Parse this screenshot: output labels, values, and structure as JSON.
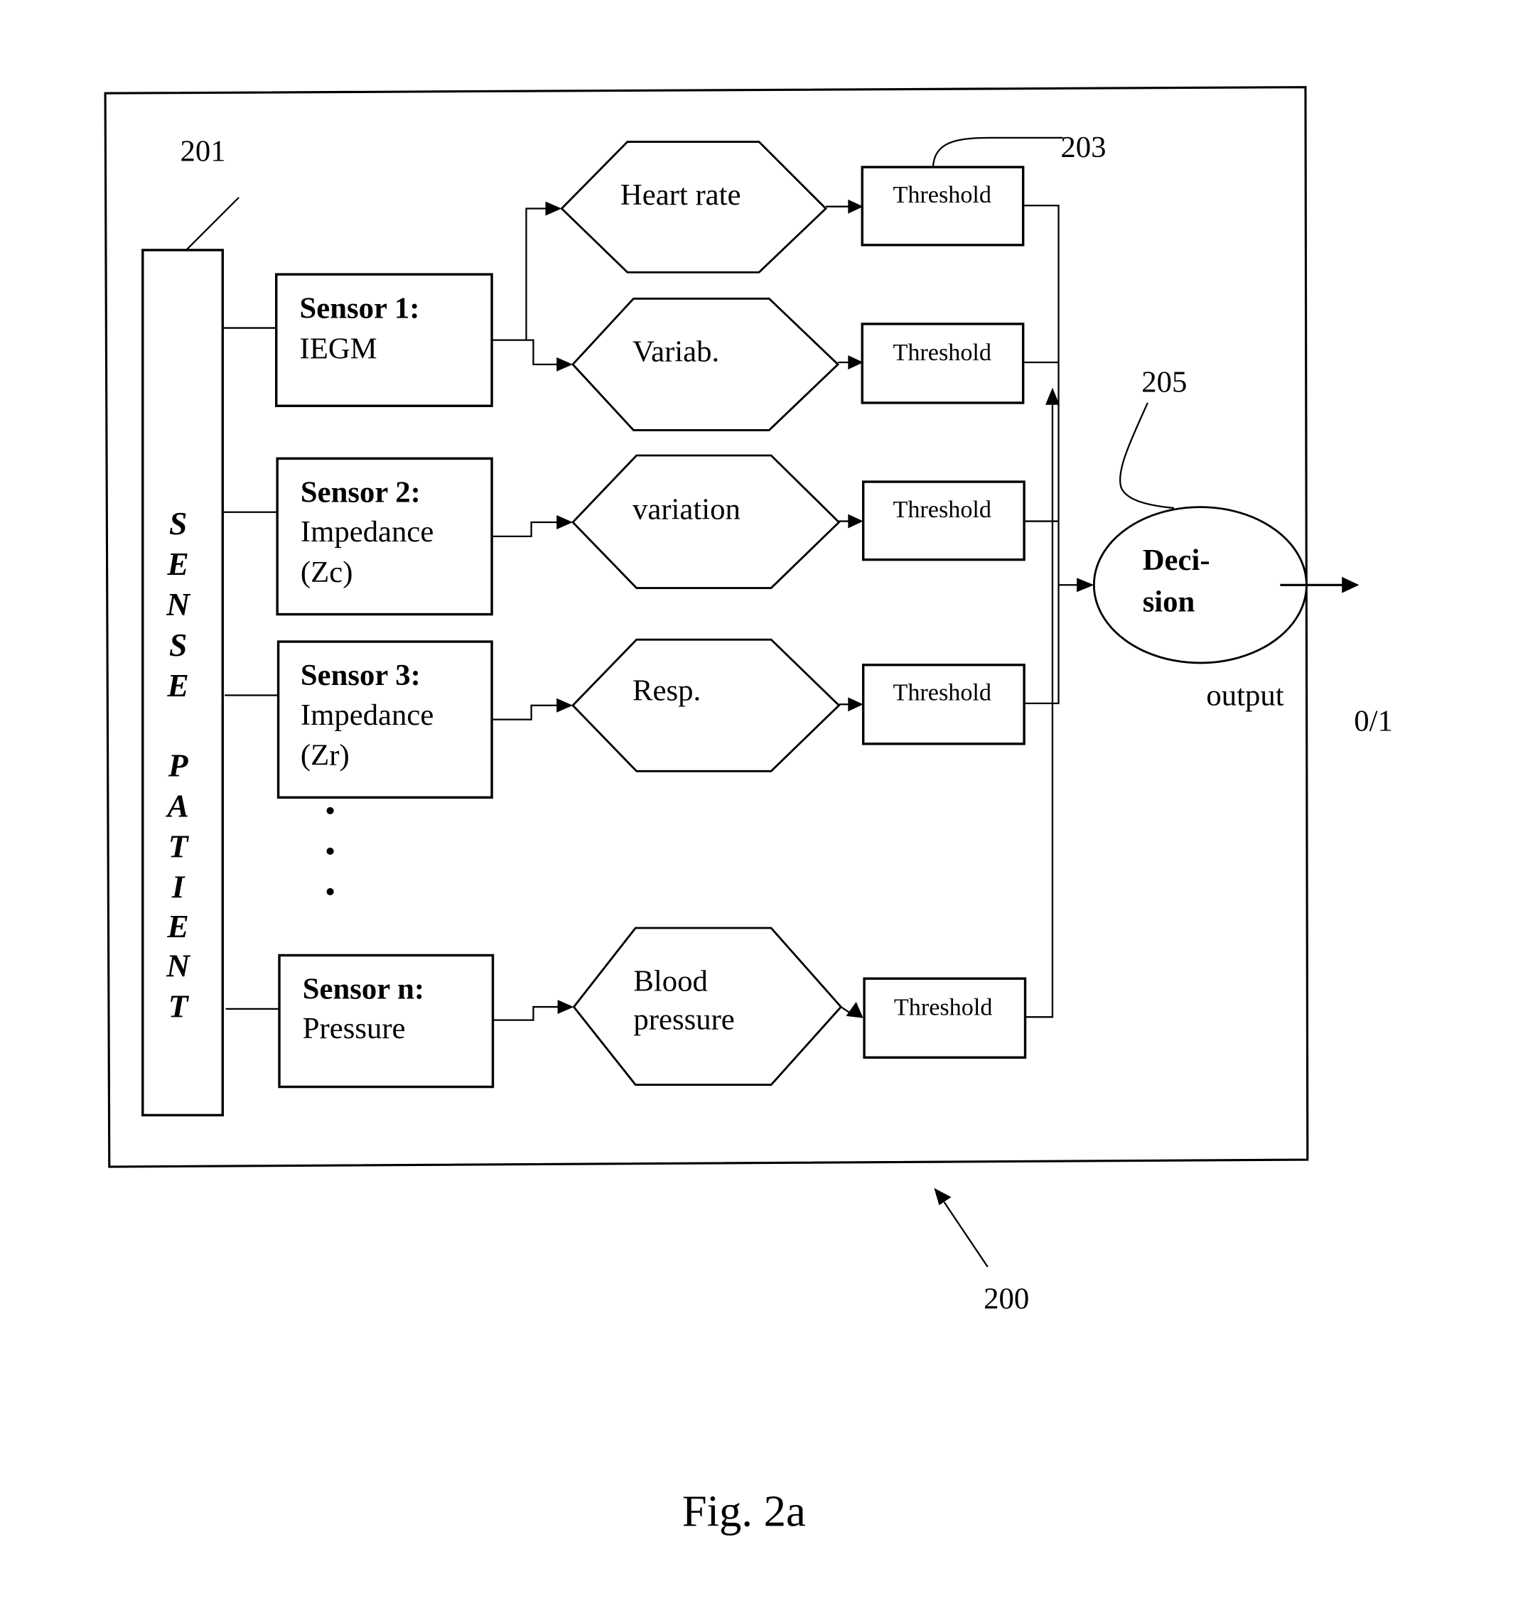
{
  "figure": {
    "caption": "Fig. 2a",
    "reference_numerals": {
      "sense_column": "201",
      "threshold": "203",
      "decision": "205",
      "system": "200"
    }
  },
  "sense_patient": {
    "letters": [
      "S",
      "E",
      "N",
      "S",
      "E",
      "",
      "P",
      "A",
      "T",
      "I",
      "E",
      "N",
      "T"
    ]
  },
  "sensors": [
    {
      "title": "Sensor 1:",
      "lines": [
        "IEGM"
      ]
    },
    {
      "title": "Sensor 2:",
      "lines": [
        "Impedance",
        "(Zc)"
      ]
    },
    {
      "title": "Sensor 3:",
      "lines": [
        "Impedance",
        "(Zr)"
      ]
    },
    {
      "title": "Sensor n:",
      "lines": [
        "Pressure"
      ]
    }
  ],
  "ellipsis_dots": [
    "•",
    "•",
    "•"
  ],
  "features": [
    {
      "lines": [
        "Heart rate"
      ]
    },
    {
      "lines": [
        "Variab."
      ]
    },
    {
      "lines": [
        "variation"
      ]
    },
    {
      "lines": [
        "Resp."
      ]
    },
    {
      "lines": [
        "Blood",
        "pressure"
      ]
    }
  ],
  "thresholds": [
    "Threshold",
    "Threshold",
    "Threshold",
    "Threshold",
    "Threshold"
  ],
  "decision": {
    "lines": [
      "Deci-",
      "sion"
    ]
  },
  "output": {
    "label": "output",
    "value": "0/1"
  }
}
